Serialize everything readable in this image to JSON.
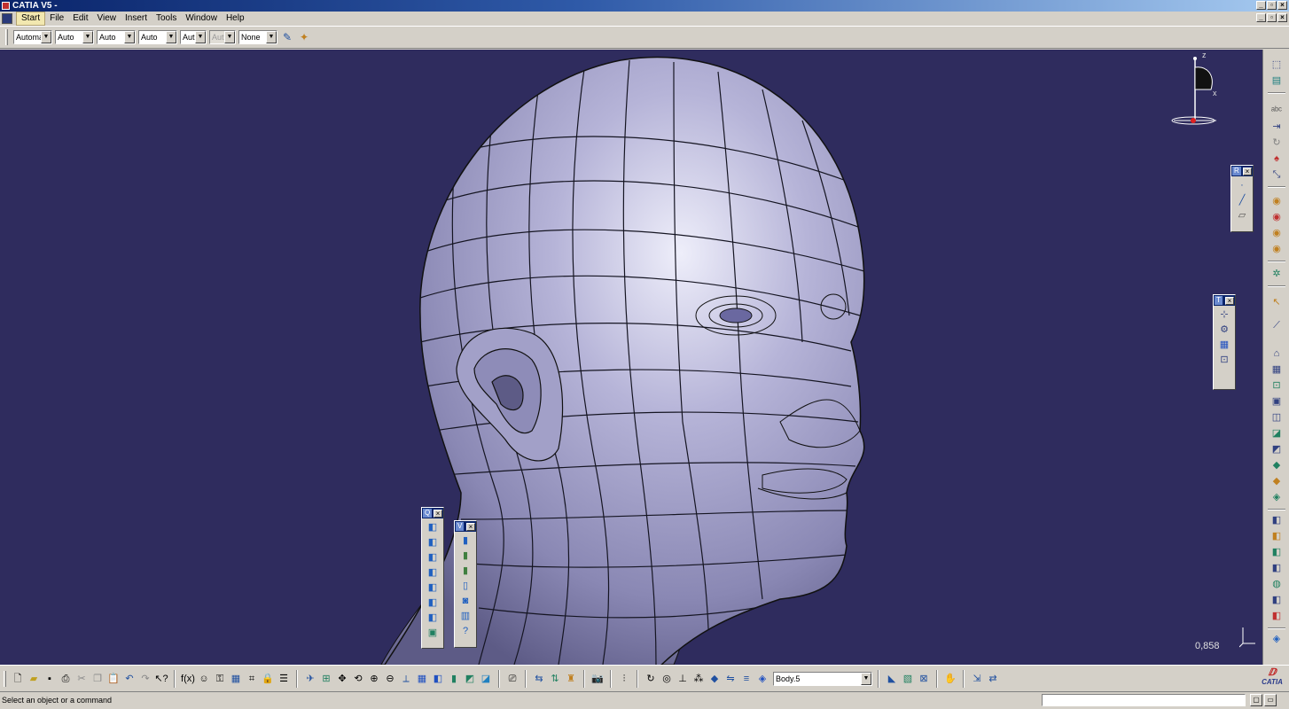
{
  "window": {
    "title": "CATIA V5 -"
  },
  "menu": {
    "items": [
      "Start",
      "File",
      "Edit",
      "View",
      "Insert",
      "Tools",
      "Window",
      "Help"
    ]
  },
  "graphic_toolbar": {
    "combos": [
      {
        "value": "Automa",
        "enabled": true
      },
      {
        "value": "Auto",
        "enabled": true
      },
      {
        "value": "Auto",
        "enabled": true
      },
      {
        "value": "Auto",
        "enabled": true
      },
      {
        "value": "Aut",
        "enabled": true
      },
      {
        "value": "Aut",
        "enabled": false
      },
      {
        "value": "None",
        "enabled": true
      }
    ],
    "icons": [
      "painter-brush-icon",
      "sparkle-icon"
    ]
  },
  "palettes": {
    "right_small": {
      "title": "R",
      "icons": [
        "point-icon",
        "line-icon",
        "plane-icon"
      ]
    },
    "tools": {
      "title": "T",
      "icons": [
        "compass-snap-icon",
        "axis-icon",
        "grid-icon",
        "fit-icon"
      ]
    },
    "quick_view": {
      "title": "Q",
      "icons": [
        "iso-view-icon",
        "front-view-icon",
        "back-view-icon",
        "left-view-icon",
        "right-view-icon",
        "top-view-icon",
        "bottom-view-icon",
        "named-view-icon"
      ]
    },
    "view_mode": {
      "title": "V",
      "icons": [
        "shading-icon",
        "shading-edges-icon",
        "shading-hidden-icon",
        "wireframe-icon",
        "shading-material-icon",
        "hidden-line-icon",
        "custom-view-icon"
      ]
    }
  },
  "viewport": {
    "zoom_readout": "0,858",
    "compass_labels": {
      "z": "z",
      "x": "x",
      "y": "y"
    }
  },
  "bottom_toolbar": {
    "body_selector": "Body.5"
  },
  "status": {
    "message": "Select an object or a command"
  },
  "brand": {
    "logo_text": "CATIA"
  },
  "colors": {
    "viewport_bg": "#2f2c5e",
    "surface": "#b6b4d8",
    "mesh_lines": "#111111"
  }
}
